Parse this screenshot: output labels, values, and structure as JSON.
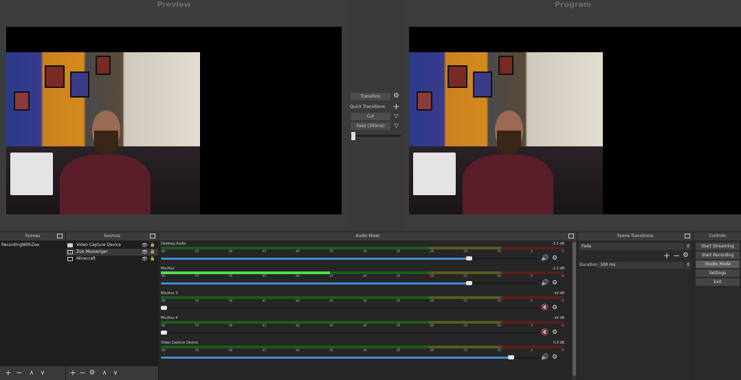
{
  "preview": {
    "title": "Preview"
  },
  "program": {
    "title": "Program"
  },
  "transition_panel": {
    "transition_label": "Transition",
    "quick_transitions_label": "Quick Transitions",
    "cut_label": "Cut",
    "fade_label": "Fade (300ms)",
    "tbar_value": 0
  },
  "scenes": {
    "title": "Scenes",
    "items": [
      "RecordingWithZoe"
    ]
  },
  "sources": {
    "title": "Sources",
    "items": [
      {
        "label": "Video Capture Device",
        "icon": "camera-icon"
      },
      {
        "label": "Zoe Messenger",
        "icon": "window-icon"
      },
      {
        "label": "Minecraft",
        "icon": "window-icon"
      }
    ]
  },
  "audio_mixer": {
    "title": "Audio Mixer",
    "ticks": [
      "-60",
      "-55",
      "-50",
      "-45",
      "-40",
      "-35",
      "-30",
      "-25",
      "-20",
      "-15",
      "-10",
      "-5",
      "0"
    ],
    "channels": [
      {
        "name": "Desktop Audio",
        "db": "-2.1 dB",
        "level": 0,
        "volume": 0.82,
        "muted": false
      },
      {
        "name": "Mic/Aux",
        "db": "-2.2 dB",
        "level": 0.42,
        "volume": 0.82,
        "muted": false
      },
      {
        "name": "Mic/Aux 3",
        "db": "-inf dB",
        "level": 0,
        "volume": 0.0,
        "muted": true
      },
      {
        "name": "Mic/Aux 4",
        "db": "-inf dB",
        "level": 0,
        "volume": 0.0,
        "muted": true
      },
      {
        "name": "Video Capture Device",
        "db": "0.0 dB",
        "level": 0,
        "volume": 0.93,
        "muted": false
      }
    ]
  },
  "scene_transitions": {
    "title": "Scene Transitions",
    "selected": "Fade",
    "duration_label": "Duration",
    "duration_value": "300 ms"
  },
  "controls": {
    "title": "Controls",
    "buttons": [
      {
        "label": "Start Streaming",
        "active": false
      },
      {
        "label": "Start Recording",
        "active": false
      },
      {
        "label": "Studio Mode",
        "active": true
      },
      {
        "label": "Settings",
        "active": false
      },
      {
        "label": "Exit",
        "active": false
      }
    ]
  },
  "colors": {
    "meter_green": "#4fe04f",
    "volume_blue": "#3f8ed6",
    "muted_red": "#d21e1e"
  }
}
